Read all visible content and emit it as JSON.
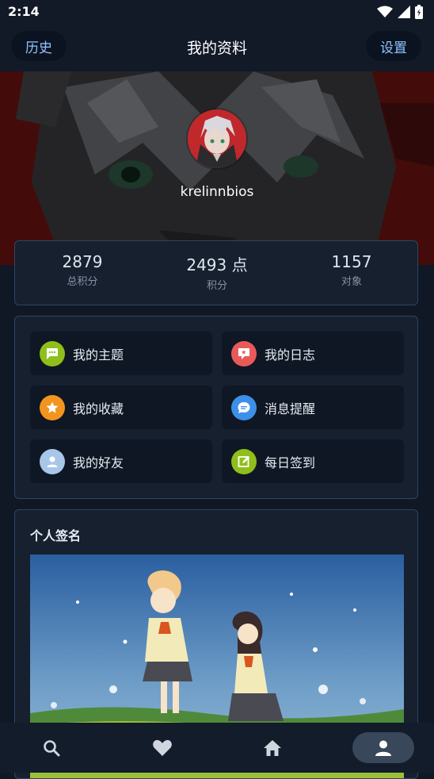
{
  "status": {
    "time": "2:14"
  },
  "top_bar": {
    "title": "我的资料",
    "left_button": "历史",
    "right_button": "设置"
  },
  "profile": {
    "username": "krelinnbios"
  },
  "stats": [
    {
      "value": "2879",
      "label": "总积分"
    },
    {
      "value": "2493 点",
      "label": "积分"
    },
    {
      "value": "1157",
      "label": "对象"
    }
  ],
  "menu": [
    {
      "label": "我的主题",
      "icon": "chat-bubble-icon",
      "color": "#8fbf1a"
    },
    {
      "label": "我的日志",
      "icon": "message-icon",
      "color": "#e85a5a"
    },
    {
      "label": "我的收藏",
      "icon": "star-icon",
      "color": "#f2951f"
    },
    {
      "label": "消息提醒",
      "icon": "message-icon",
      "color": "#3d8fe8"
    },
    {
      "label": "我的好友",
      "icon": "person-icon",
      "color": "#a8c6e8"
    },
    {
      "label": "每日签到",
      "icon": "edit-icon",
      "color": "#8fbf1a"
    }
  ],
  "signature": {
    "title": "个人签名"
  },
  "bottom_nav": [
    {
      "name": "search",
      "icon": "search-icon"
    },
    {
      "name": "favorites",
      "icon": "heart-icon"
    },
    {
      "name": "home",
      "icon": "home-icon"
    },
    {
      "name": "profile",
      "icon": "person-icon",
      "active": true
    }
  ]
}
